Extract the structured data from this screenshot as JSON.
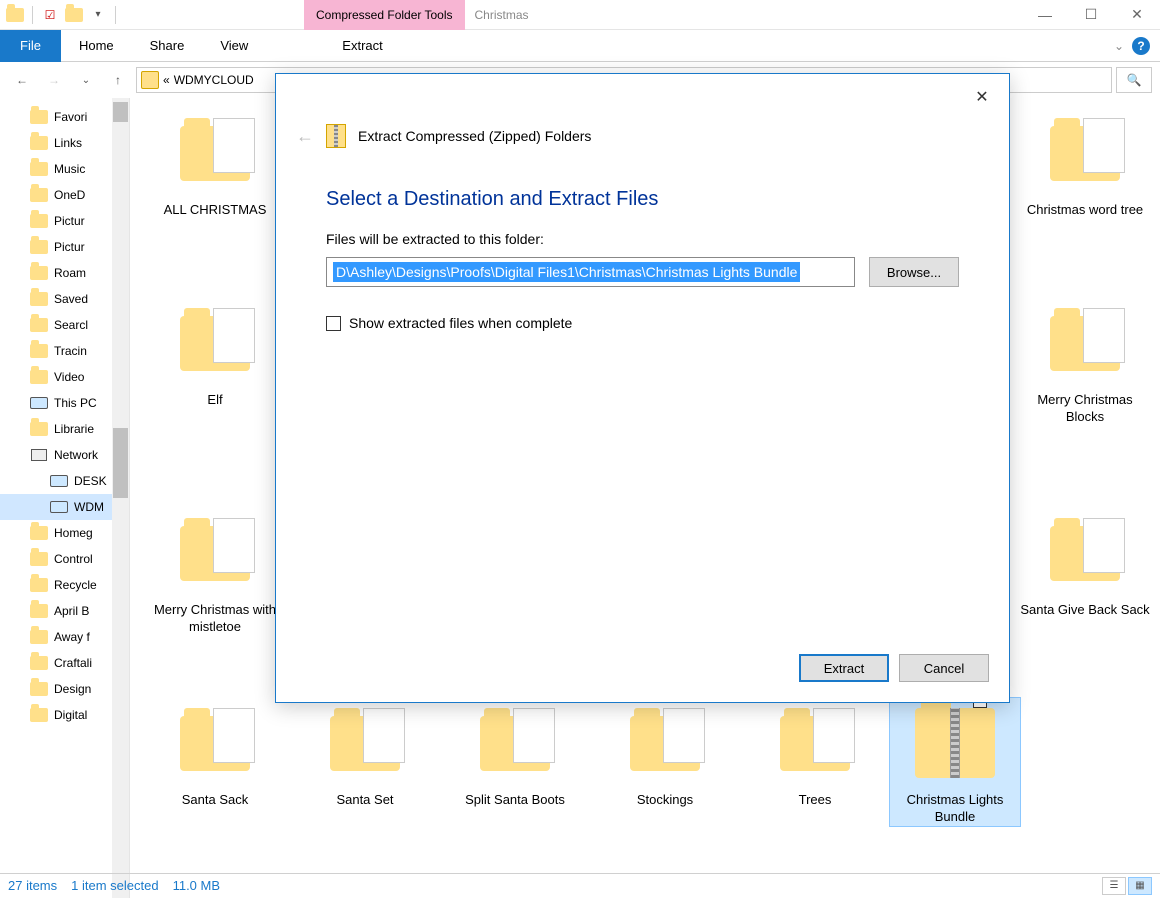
{
  "titlebar": {
    "contextual_tab": "Compressed Folder Tools",
    "window_title": "Christmas"
  },
  "ribbon": {
    "file": "File",
    "tabs": [
      "Home",
      "Share",
      "View"
    ],
    "extract": "Extract"
  },
  "address": {
    "prefix": "«",
    "path": "WDMYCLOUD"
  },
  "sidebar": {
    "items": [
      {
        "label": "Favori",
        "icon": "folder"
      },
      {
        "label": "Links",
        "icon": "folder"
      },
      {
        "label": "Music",
        "icon": "folder"
      },
      {
        "label": "OneD",
        "icon": "folder"
      },
      {
        "label": "Pictur",
        "icon": "folder"
      },
      {
        "label": "Pictur",
        "icon": "folder"
      },
      {
        "label": "Roam",
        "icon": "folder"
      },
      {
        "label": "Saved",
        "icon": "folder"
      },
      {
        "label": "Searcl",
        "icon": "folder"
      },
      {
        "label": "Tracin",
        "icon": "folder"
      },
      {
        "label": "Video",
        "icon": "folder"
      },
      {
        "label": "This PC",
        "icon": "pc"
      },
      {
        "label": "Librarie",
        "icon": "folder"
      },
      {
        "label": "Network",
        "icon": "net"
      },
      {
        "label": "DESK",
        "icon": "pc",
        "indent": true
      },
      {
        "label": "WDM",
        "icon": "pc",
        "indent": true,
        "selected": true
      },
      {
        "label": "Homeg",
        "icon": "folder"
      },
      {
        "label": "Control",
        "icon": "folder"
      },
      {
        "label": "Recycle",
        "icon": "folder"
      },
      {
        "label": "April B",
        "icon": "folder"
      },
      {
        "label": "Away f",
        "icon": "folder"
      },
      {
        "label": "Craftali",
        "icon": "folder"
      },
      {
        "label": "Design",
        "icon": "folder"
      },
      {
        "label": "Digital",
        "icon": "folder"
      }
    ]
  },
  "folders": [
    {
      "label": "ALL CHRISTMAS"
    },
    {
      "label": "Christmas word tree"
    },
    {
      "label": "Elf"
    },
    {
      "label": "Merry Christmas Blocks"
    },
    {
      "label": "Merry Christmas with mistletoe"
    },
    {
      "label": "Santa Give Back Sack"
    },
    {
      "label": "Santa Sack"
    },
    {
      "label": "Santa Set"
    },
    {
      "label": "Split Santa Boots"
    },
    {
      "label": "Stockings"
    },
    {
      "label": "Trees"
    },
    {
      "label": "Christmas Lights Bundle",
      "zip": true,
      "selected": true
    }
  ],
  "statusbar": {
    "count": "27 items",
    "selection": "1 item selected",
    "size": "11.0 MB"
  },
  "dialog": {
    "title": "Extract Compressed (Zipped) Folders",
    "heading": "Select a Destination and Extract Files",
    "instruction": "Files will be extracted to this folder:",
    "path": "D\\Ashley\\Designs\\Proofs\\Digital Files1\\Christmas\\Christmas Lights Bundle",
    "browse": "Browse...",
    "show_label": "Show extracted files when complete",
    "extract": "Extract",
    "cancel": "Cancel"
  }
}
